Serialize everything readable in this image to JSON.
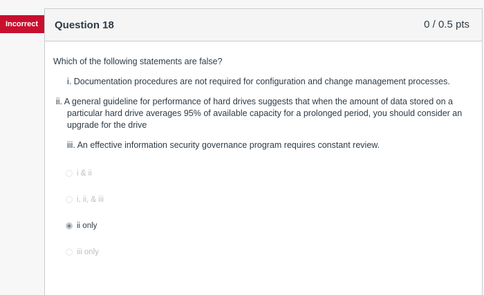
{
  "result_badge": "Incorrect",
  "question": {
    "title": "Question 18",
    "points": "0 / 0.5 pts",
    "stem": "Which of the following statements are false?",
    "statements": [
      "i. Documentation procedures are not required for configuration and change management processes.",
      "ii. A general guideline for performance of hard drives suggests that when the amount of data stored on a particular hard drive averages 95% of available capacity for a prolonged period, you should consider an upgrade for the drive",
      "iii. An effective information security governance program requires constant review."
    ],
    "answers": [
      {
        "label": "i & ii",
        "selected": false
      },
      {
        "label": "i, ii, & iii",
        "selected": false
      },
      {
        "label": "ii only",
        "selected": true
      },
      {
        "label": "iii only",
        "selected": false
      }
    ]
  }
}
